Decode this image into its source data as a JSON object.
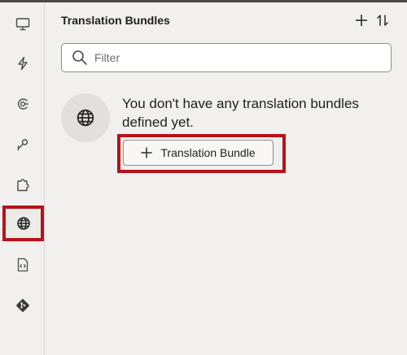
{
  "panel": {
    "title": "Translation Bundles",
    "add_icon": "plus-icon",
    "sort_icon": "sort-icon"
  },
  "filter": {
    "placeholder": "Filter",
    "value": ""
  },
  "empty_state": {
    "icon": "globe-icon",
    "message": "You don't have any translation bundles defined yet.",
    "button_label": "Translation Bundle"
  },
  "sidebar": {
    "items": [
      {
        "id": "pages",
        "icon": "monitor-icon"
      },
      {
        "id": "events",
        "icon": "lightning-icon"
      },
      {
        "id": "variables",
        "icon": "target-icon"
      },
      {
        "id": "types",
        "icon": "wrench-icon"
      },
      {
        "id": "components",
        "icon": "puzzle-icon"
      },
      {
        "id": "translations",
        "icon": "globe-icon",
        "active": true
      },
      {
        "id": "source",
        "icon": "code-file-icon"
      },
      {
        "id": "git",
        "icon": "git-icon"
      }
    ]
  },
  "colors": {
    "highlight": "#b8111a",
    "background": "#f1f0ee"
  }
}
